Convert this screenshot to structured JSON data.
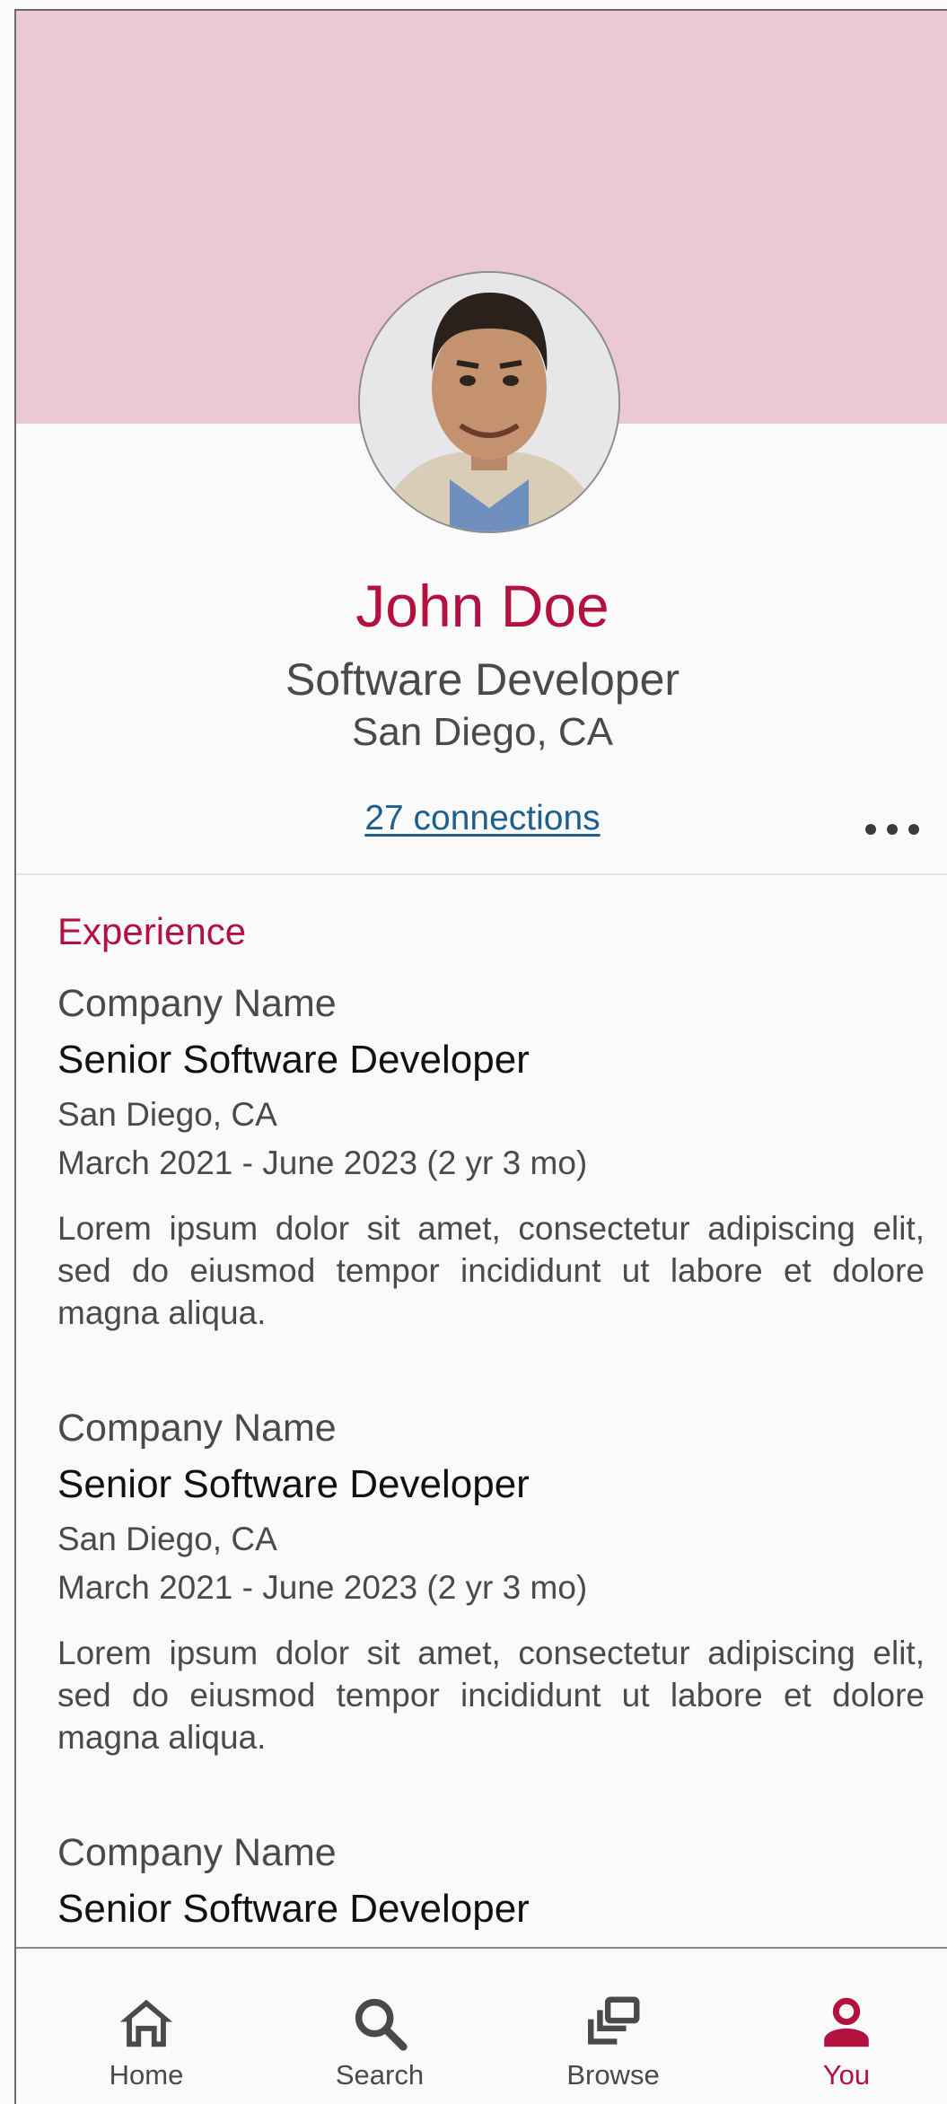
{
  "profile": {
    "name": "John Doe",
    "title": "Software Developer",
    "location": "San Diego, CA",
    "connections": "27 connections"
  },
  "experience": {
    "heading": "Experience",
    "items": [
      {
        "company": "Company Name",
        "role": "Senior Software Developer",
        "location": "San Diego, CA",
        "dates": "March 2021 - June 2023 (2 yr 3 mo)",
        "description": "Lorem ipsum dolor sit amet, consectetur adipiscing elit, sed do eiusmod tempor incididunt ut labore et dolore magna aliqua."
      },
      {
        "company": "Company Name",
        "role": "Senior Software Developer",
        "location": "San Diego, CA",
        "dates": "March 2021 - June 2023 (2 yr 3 mo)",
        "description": "Lorem ipsum dolor sit amet, consectetur adipiscing elit, sed do eiusmod tempor incididunt ut labore et dolore magna aliqua."
      },
      {
        "company": "Company Name",
        "role": "Senior Software Developer"
      }
    ]
  },
  "nav": {
    "items": [
      {
        "label": "Home",
        "icon": "home-icon"
      },
      {
        "label": "Search",
        "icon": "search-icon"
      },
      {
        "label": "Browse",
        "icon": "browse-icon"
      },
      {
        "label": "You",
        "icon": "person-icon",
        "active": true
      }
    ]
  },
  "colors": {
    "accent": "#b3113f",
    "cover": "#eac9d2",
    "link": "#1f5f8f",
    "text": "#4a4a4a"
  }
}
